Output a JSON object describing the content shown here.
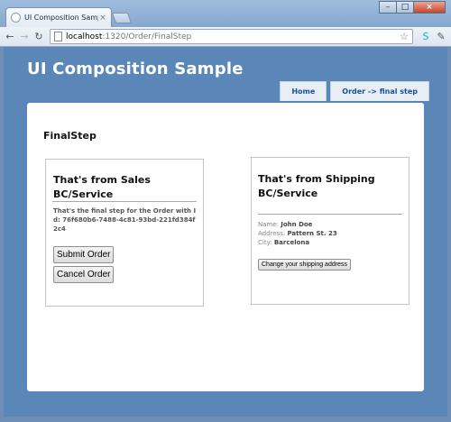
{
  "browser": {
    "tab_title": "UI Composition Sample",
    "tab_close": "×",
    "url_host": "localhost",
    "url_path": ":1320/Order/FinalStep",
    "back": "←",
    "forward": "→",
    "reload": "↻",
    "star": "☆",
    "window_buttons": {
      "minimize": "–",
      "maximize": "□",
      "close": "×"
    }
  },
  "site": {
    "title": "UI Composition Sample",
    "menu": [
      {
        "label": "Home"
      },
      {
        "label": "Order -> final step"
      }
    ]
  },
  "page": {
    "title": "FinalStep",
    "sales": {
      "title": "That's from Sales BC/Service",
      "description": "That's the final step for the Order with Id: 76f680b6-7488-4c81-93bd-221fd384f2c4",
      "submit_label": "Submit Order",
      "cancel_label": "Cancel Order"
    },
    "shipping": {
      "title": "That's from Shipping BC/Service",
      "name_label": "Name:",
      "name_value": "John Doe",
      "address_label": "Address:",
      "address_value": "Pattern St. 23",
      "city_label": "City:",
      "city_value": "Barcelona",
      "change_address_label": "Change your shipping address"
    }
  },
  "icons": {
    "skype": "S",
    "wrench": "✎"
  }
}
